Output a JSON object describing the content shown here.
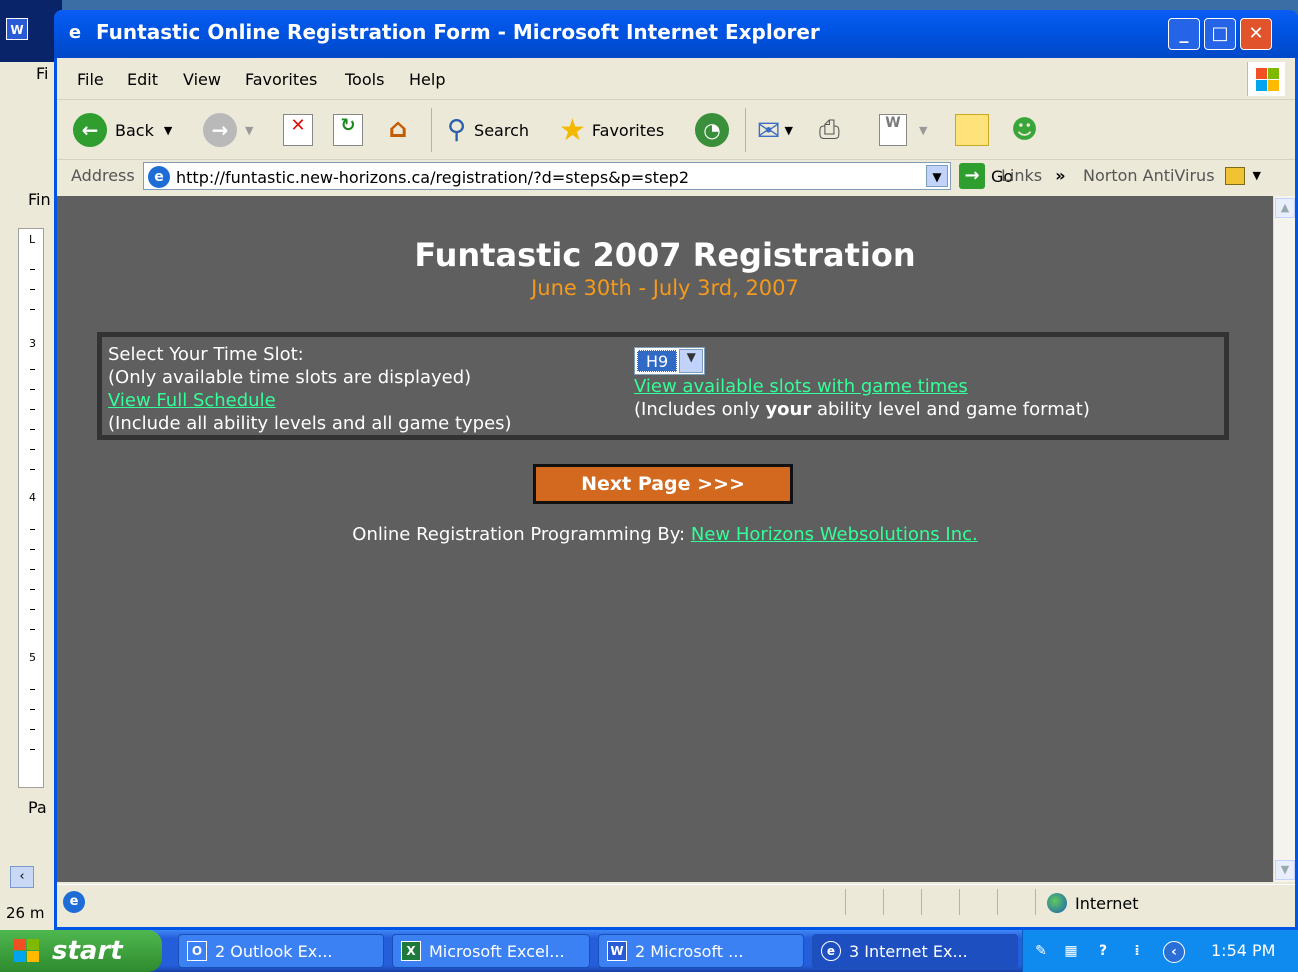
{
  "background_word": {
    "menu_partial": "Fi",
    "find_partial": "Fin",
    "page_partial": "Pa",
    "status_partial": "26 m",
    "ruler_marks": [
      "L",
      "3",
      "4",
      "5"
    ]
  },
  "window": {
    "title": "Funtastic Online Registration Form - Microsoft Internet Explorer",
    "minimize": "_",
    "maximize": "□",
    "close": "✕"
  },
  "menu": {
    "items": [
      "File",
      "Edit",
      "View",
      "Favorites",
      "Tools",
      "Help"
    ]
  },
  "toolbar": {
    "back_label": "Back",
    "search_label": "Search",
    "favorites_label": "Favorites"
  },
  "address": {
    "label": "Address",
    "url": "http://funtastic.new-horizons.ca/registration/?d=steps&p=step2",
    "go_label": "Go",
    "links_label": "Links",
    "links_chevron": "»",
    "norton_label": "Norton AntiVirus"
  },
  "page": {
    "title": "Funtastic 2007 Registration",
    "subtitle": "June 30th - July 3rd, 2007",
    "slot": {
      "label": "Select Your Time Slot:",
      "note": "(Only available time slots are displayed)",
      "full_schedule_link": "View Full Schedule",
      "full_schedule_note": "(Include all ability levels and all game types)",
      "selected_value": "H9",
      "available_link": "View available slots with game times",
      "available_note_prefix": "(Includes only ",
      "available_note_bold": "your",
      "available_note_suffix": " ability level and game format)"
    },
    "next_button": "Next Page >>>",
    "credit_prefix": "Online Registration Programming By: ",
    "credit_link": "New Horizons Websolutions Inc."
  },
  "status": {
    "zone": "Internet"
  },
  "taskbar": {
    "start_label": "start",
    "tasks": [
      "2 Outlook Ex...",
      "Microsoft Excel...",
      "2 Microsoft ...",
      "3 Internet Ex..."
    ],
    "clock": "1:54 PM"
  },
  "colors": {
    "page_bg": "#5f5f5f",
    "subtitle": "#f59a1b",
    "link": "#33ff99",
    "next_button": "#d2691e"
  }
}
